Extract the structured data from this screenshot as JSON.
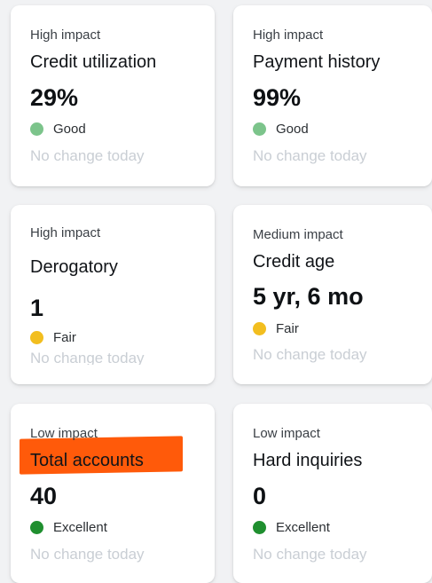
{
  "cards": [
    {
      "impact": "High impact",
      "title": "Credit utilization",
      "value": "29%",
      "status": "Good",
      "status_color": "#7cc48b",
      "change": "No change today"
    },
    {
      "impact": "High impact",
      "title": "Payment history",
      "value": "99%",
      "status": "Good",
      "status_color": "#7cc48b",
      "change": "No change today"
    },
    {
      "impact": "High impact",
      "title": "Derogatory",
      "value": "1",
      "status": "Fair",
      "status_color": "#f2be1f",
      "change": "No change today"
    },
    {
      "impact": "Medium impact",
      "title": "Credit age",
      "value": "5 yr, 6 mo",
      "status": "Fair",
      "status_color": "#f2be1f",
      "change": "No change today"
    },
    {
      "impact": "Low impact",
      "title": "Total accounts",
      "value": "40",
      "status": "Excellent",
      "status_color": "#1f8f2f",
      "change": "No change today"
    },
    {
      "impact": "Low impact",
      "title": "Hard inquiries",
      "value": "0",
      "status": "Excellent",
      "status_color": "#1f8f2f",
      "change": "No change today"
    }
  ],
  "highlight_color": "#ff5a0a"
}
